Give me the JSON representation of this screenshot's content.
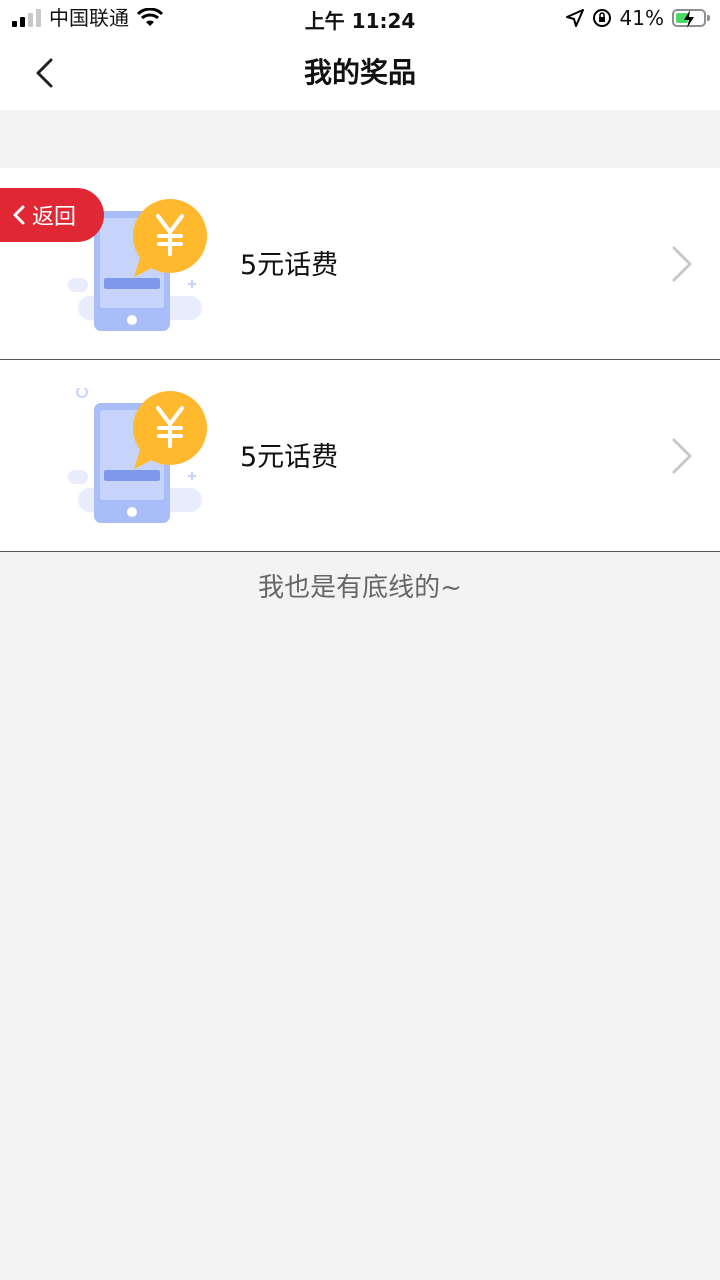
{
  "status_bar": {
    "carrier": "中国联通",
    "time": "上午 11:24",
    "battery_percent": "41%",
    "signal_icon": "cellular-signal-icon",
    "wifi_icon": "wifi-icon",
    "location_icon": "location-arrow-icon",
    "rotation_lock_icon": "rotation-lock-icon",
    "battery_icon": "battery-charging-icon",
    "battery_level": 0.41
  },
  "nav": {
    "title": "我的奖品",
    "back_icon": "chevron-left-icon"
  },
  "floating_back": {
    "label": "返回",
    "icon": "chevron-left-icon",
    "color": "#e02834"
  },
  "prizes": [
    {
      "label": "5元话费",
      "icon": "phone-yuan-icon",
      "arrow_icon": "chevron-right-icon"
    },
    {
      "label": "5元话费",
      "icon": "phone-yuan-icon",
      "arrow_icon": "chevron-right-icon"
    }
  ],
  "footer": {
    "note": "我也是有底线的~"
  }
}
